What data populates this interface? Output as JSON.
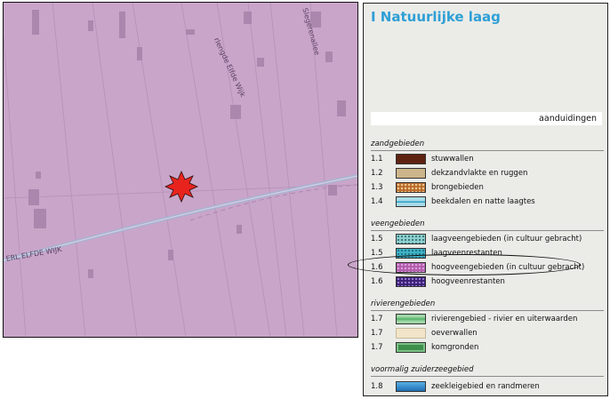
{
  "map": {
    "road_labels": [
      "rlengde Elfde Wijk",
      "Slegerenallee",
      "ERL ELFDE WIJK"
    ],
    "fill_color": "#c9a5c9",
    "marker": "red-star-burst"
  },
  "legend": {
    "title": "I Natuurlijke laag",
    "aanduidingen": "aanduidingen",
    "sections": [
      {
        "title": "zandgebieden",
        "items": [
          {
            "code": "1.1",
            "label": "stuwwallen",
            "color": "#5e2311"
          },
          {
            "code": "1.2",
            "label": "dekzandvlakte en ruggen",
            "color": "#cdb58b"
          },
          {
            "code": "1.3",
            "label": "brongebieden",
            "color": "#b96a2a"
          },
          {
            "code": "1.4",
            "label": "beekdalen en natte laagtes",
            "color": "#a8dbe8"
          }
        ]
      },
      {
        "title": "veengebieden",
        "items": [
          {
            "code": "1.5",
            "label": "laagveengebieden (in cultuur gebracht)",
            "color": "#8fd0cf"
          },
          {
            "code": "1.5",
            "label": "laagveenrestanten",
            "color": "#3fb2c4"
          },
          {
            "code": "1.6",
            "label": "hoogveengebieden (in cultuur gebracht)",
            "color": "#b25cae"
          },
          {
            "code": "1.6",
            "label": "hoogveenrestanten",
            "color": "#3a1f73"
          }
        ]
      },
      {
        "title": "rivierengebieden",
        "items": [
          {
            "code": "1.7",
            "label": "rivierengebied - rivier en uiterwaarden",
            "color": "#63b873"
          },
          {
            "code": "1.7",
            "label": "oeverwallen",
            "color": "#f1e4c9"
          },
          {
            "code": "1.7",
            "label": "komgronden",
            "color": "#3f8f4c"
          }
        ]
      },
      {
        "title": "voormalig zuiderzeegebied",
        "items": [
          {
            "code": "1.8",
            "label": "zeekleigebied en randmeren",
            "color": "#2a86c8"
          }
        ]
      }
    ]
  }
}
